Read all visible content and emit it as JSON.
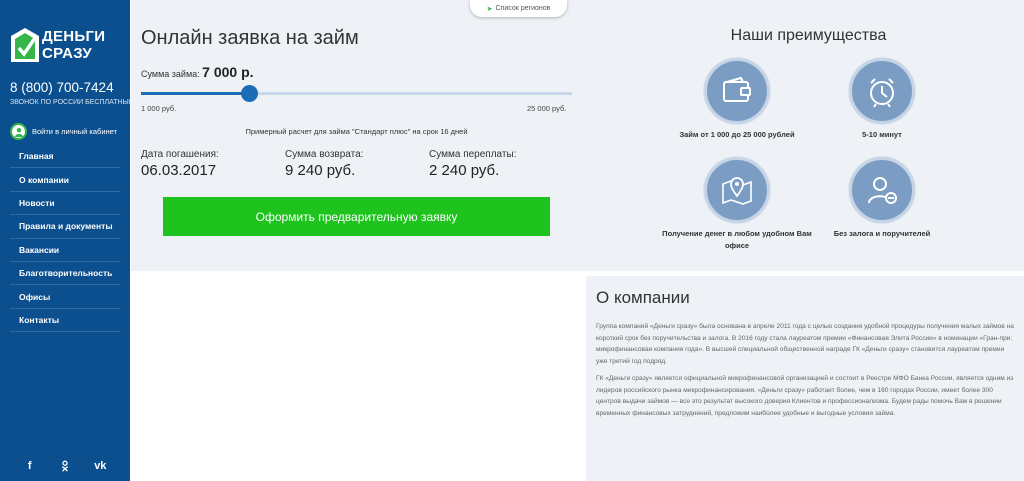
{
  "brand": {
    "line1": "ДЕНЬГИ",
    "line2": "СРАЗУ",
    "colors": {
      "sidebar": "#0b4f8f",
      "accent_green": "#1ec31e",
      "slider_blue": "#1b6db5"
    }
  },
  "contact": {
    "phone": "8 (800) 700-7424",
    "phone_note": "ЗВОНОК ПО РОССИИ БЕСПЛАТНЫЙ"
  },
  "cabinet": {
    "label": "Войти в личный кабинет",
    "icon": "user-icon"
  },
  "nav": {
    "items": [
      {
        "label": "Главная"
      },
      {
        "label": "О компании"
      },
      {
        "label": "Новости"
      },
      {
        "label": "Правила и документы"
      },
      {
        "label": "Вакансии"
      },
      {
        "label": "Благотворительность"
      },
      {
        "label": "Офисы"
      },
      {
        "label": "Контакты"
      }
    ]
  },
  "socials": {
    "facebook": "f",
    "odnoklassniki": "ok",
    "vk": "vk"
  },
  "regions": {
    "label": "Список регионов"
  },
  "calculator": {
    "title": "Онлайн заявка на займ",
    "sum_label": "Сумма займа: ",
    "sum_value": "7 000 р.",
    "slider": {
      "min_label": "1 000 руб.",
      "max_label": "25 000 руб.",
      "min": 1000,
      "max": 25000,
      "value": 7000
    },
    "note": "Примерный расчет для займа \"Стандарт плюс\" на срок 16 дней",
    "results": [
      {
        "label": "Дата погашения:",
        "value": "06.03.2017"
      },
      {
        "label": "Сумма возврата:",
        "value": "9 240 руб."
      },
      {
        "label": "Сумма переплаты:",
        "value": "2 240 руб."
      }
    ],
    "button_label": "Оформить предварительную заявку"
  },
  "advantages": {
    "title": "Наши преимущества",
    "items": [
      {
        "label": "Займ от 1 000 до 25 000 рублей",
        "icon": "wallet-icon"
      },
      {
        "label": "5-10 минут",
        "icon": "alarm-clock-icon"
      },
      {
        "label": "Получение денег в любом удобном Вам офисе",
        "icon": "map-pin-icon"
      },
      {
        "label": "Без залога и поручителей",
        "icon": "user-minus-icon"
      }
    ]
  },
  "about": {
    "title": "О компании",
    "paragraph1": "Группа компаний «Деньги сразу» была основана в апреле 2011 года с целью создания удобной процедуры получения малых займов на короткий срок без поручительства и залога. В 2016 году стала лауреатом премии «Финансовая Элита России» в номинации «Гран-при: микрофинансовая компания года». В высшей специальной общественной награде ГК «Деньги сразу» становится лауреатом премии уже третий год подряд.",
    "paragraph2": "ГК «Деньги сразу» является официальной микрофинансовой организацией и состоит в Реестре МФО Банка России, является одним из лидеров российского рынка микрофинансирования. «Деньги сразу» работает более, чем в 160 городах России, имеет более 300 центров выдачи займов — все это результат высокого доверия Клиентов и профессионализма. Будем рады помочь Вам в решении временных финансовых затруднений, предложим наиболее удобные и выгодные условия займа."
  }
}
